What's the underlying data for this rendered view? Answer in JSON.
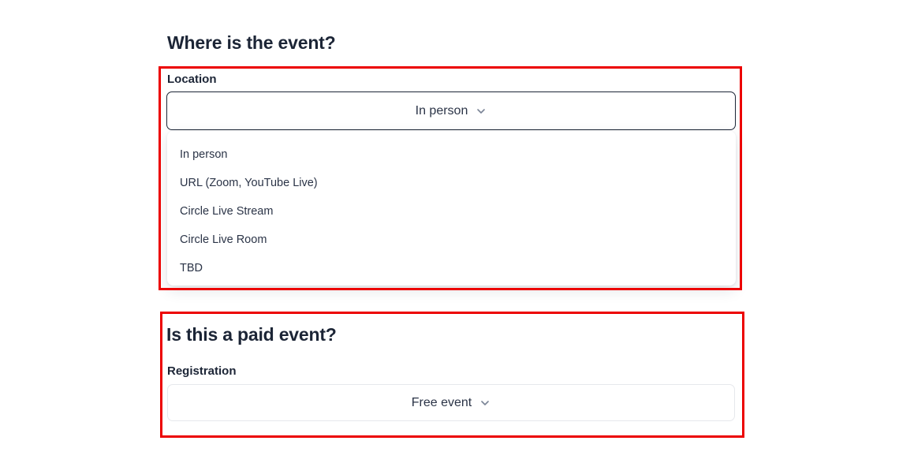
{
  "location_section": {
    "heading": "Where is the event?",
    "field_label": "Location",
    "selected_value": "In person",
    "options": [
      {
        "label": "In person"
      },
      {
        "label": "URL (Zoom, YouTube Live)"
      },
      {
        "label": "Circle Live Stream"
      },
      {
        "label": "Circle Live Room"
      },
      {
        "label": "TBD"
      }
    ]
  },
  "paid_section": {
    "heading": "Is this a paid event?",
    "field_label": "Registration",
    "selected_value": "Free event"
  },
  "icons": {
    "dropdown": "chevron-down-icon"
  },
  "colors": {
    "highlight": "#ec0000",
    "text": "#1c2536",
    "chevron": "#7a8496"
  }
}
